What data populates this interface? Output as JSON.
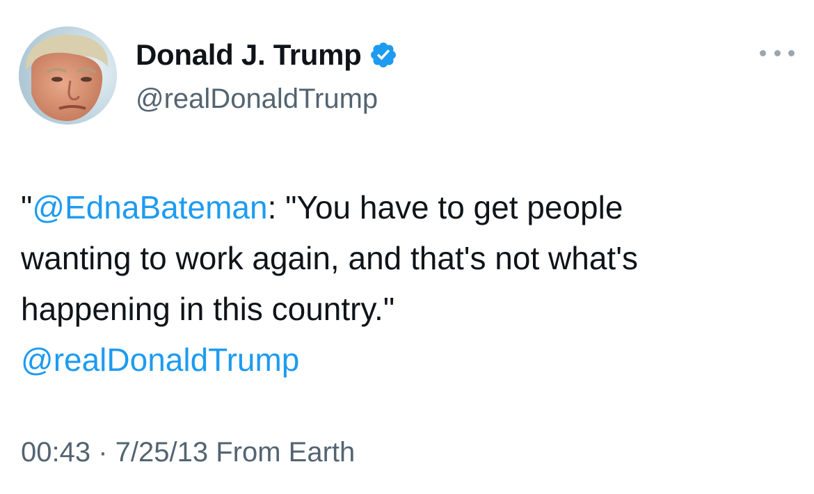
{
  "author": {
    "display_name": "Donald J. Trump",
    "handle": "@realDonaldTrump",
    "verified": true,
    "verified_color": "#1d9bf0"
  },
  "more_icon": "more-horizontal-icon",
  "tweet": {
    "line1_quote_open": "\"",
    "line1_mention": "@EdnaBateman",
    "line1_rest": ": \"You have to get people",
    "line2": "wanting to work again, and that's not what's",
    "line3": "happening in this country.\"",
    "line4_mention": "@realDonaldTrump"
  },
  "meta": {
    "time": "00:43",
    "separator": " · ",
    "date": "7/25/13",
    "source": "From Earth"
  },
  "colors": {
    "text": "#0f1419",
    "secondary": "#536471",
    "link": "#1d9bf0"
  }
}
